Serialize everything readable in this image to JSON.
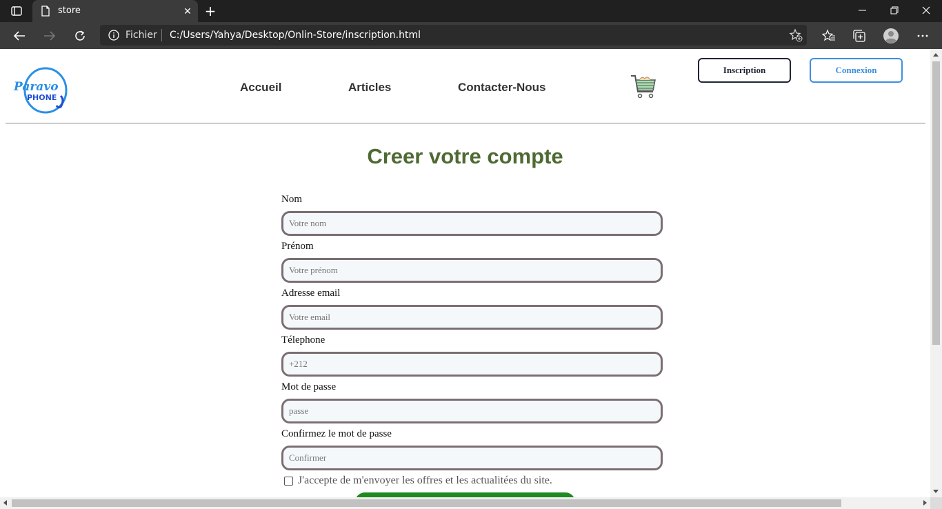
{
  "browser": {
    "tab_title": "store",
    "address_scheme": "Fichier",
    "address_url": "C:/Users/Yahya/Desktop/Onlin-Store/inscription.html"
  },
  "header": {
    "logo": {
      "line1": "Paravo",
      "line2": "PHONE"
    },
    "nav": [
      {
        "label": "Accueil"
      },
      {
        "label": "Articles"
      },
      {
        "label": "Contacter-Nous"
      }
    ],
    "inscription_label": "Inscription",
    "connexion_label": "Connexion"
  },
  "form": {
    "title": "Creer votre compte",
    "fields": [
      {
        "label": "Nom",
        "placeholder": "Votre nom"
      },
      {
        "label": "Prénom",
        "placeholder": "Votre prénom"
      },
      {
        "label": "Adresse email",
        "placeholder": "Votre email"
      },
      {
        "label": "Télephone",
        "placeholder": "+212"
      },
      {
        "label": "Mot de passe",
        "placeholder": "passe"
      },
      {
        "label": "Confirmez le mot de passe",
        "placeholder": "Confirmer"
      }
    ],
    "newsletter_label": "J'accepte de m'envoyer les offres et les actualitées du site."
  },
  "colors": {
    "title": "#4e6a33",
    "submit": "#1f8a1f",
    "connexion": "#3d8fe0",
    "input_border": "#7b6e73"
  }
}
